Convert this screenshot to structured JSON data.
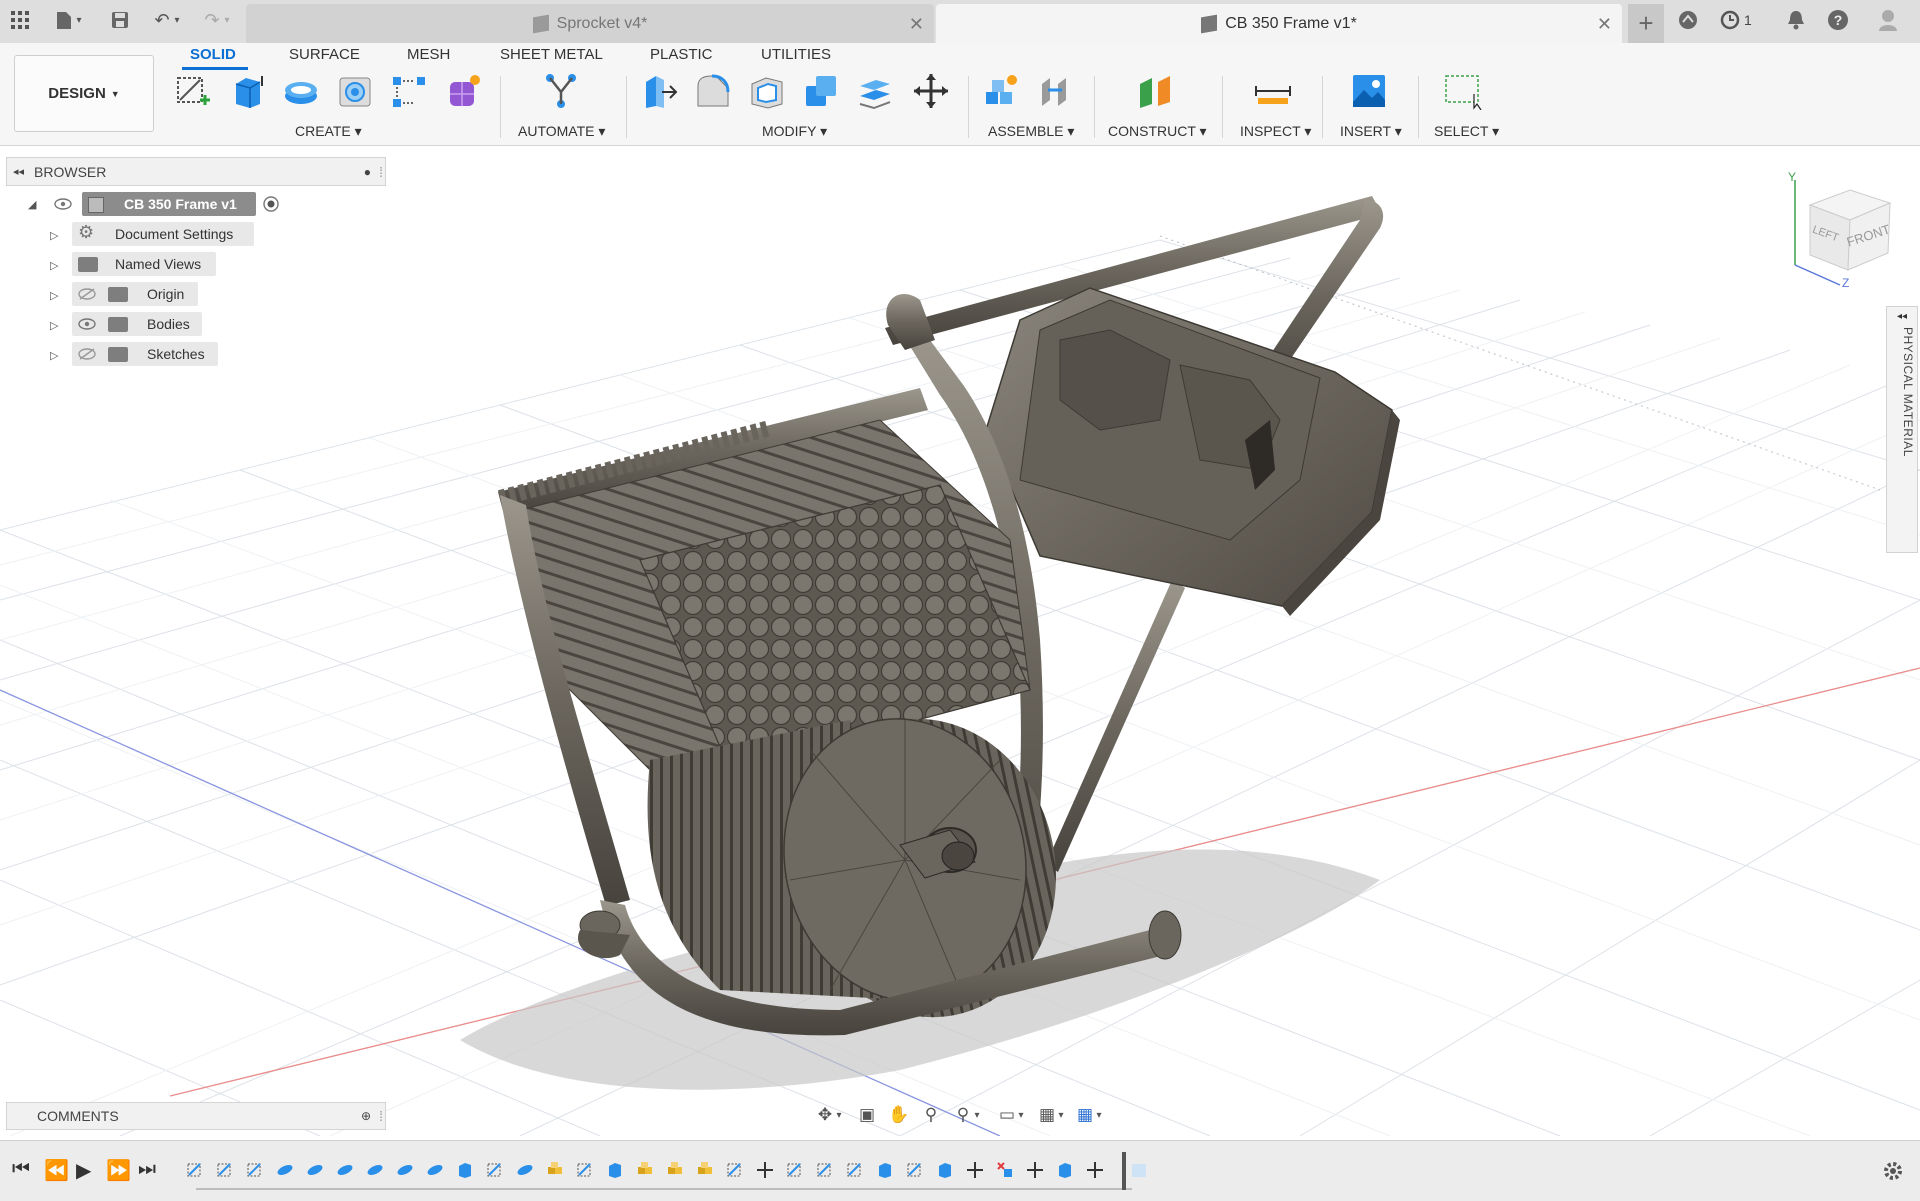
{
  "titlebar": {
    "tabs": [
      {
        "label": "Sprocket v4*",
        "active": false
      },
      {
        "label": "CB 350 Frame v1*",
        "active": true
      }
    ],
    "job_count": "1",
    "icons": [
      "app-grid-icon",
      "file-icon",
      "save-icon",
      "undo-icon",
      "redo-icon",
      "new-tab-icon",
      "extensions-icon",
      "job-status-icon",
      "notifications-icon",
      "help-icon",
      "user-avatar-icon"
    ]
  },
  "toolbar": {
    "workspace_button": "DESIGN",
    "tabs": [
      "SOLID",
      "SURFACE",
      "MESH",
      "SHEET METAL",
      "PLASTIC",
      "UTILITIES"
    ],
    "active_tab": "SOLID",
    "groups": {
      "create": "CREATE",
      "automate": "AUTOMATE",
      "modify": "MODIFY",
      "assemble": "ASSEMBLE",
      "construct": "CONSTRUCT",
      "inspect": "INSPECT",
      "insert": "INSERT",
      "select": "SELECT"
    }
  },
  "browser": {
    "title": "BROWSER",
    "root": "CB 350 Frame v1",
    "items": [
      {
        "label": "Document Settings",
        "icon": "gear-icon"
      },
      {
        "label": "Named Views",
        "icon": "folder-icon"
      },
      {
        "label": "Origin",
        "icon": "folder-icon",
        "visibility": "hidden"
      },
      {
        "label": "Bodies",
        "icon": "folder-icon",
        "visibility": "visible"
      },
      {
        "label": "Sketches",
        "icon": "folder-icon",
        "visibility": "hidden"
      }
    ]
  },
  "viewcube": {
    "left": "LEFT",
    "front": "FRONT",
    "axis_y": "Y",
    "axis_z": "Z"
  },
  "right_panel": {
    "label": "PHYSICAL MATERIAL"
  },
  "comments": {
    "title": "COMMENTS"
  },
  "colors": {
    "accent": "#0b6fd4",
    "model_metal": "#6f6a60",
    "grid_line": "#d8dde3",
    "x_axis": "#e98b8b",
    "z_axis": "#8a96e0"
  }
}
